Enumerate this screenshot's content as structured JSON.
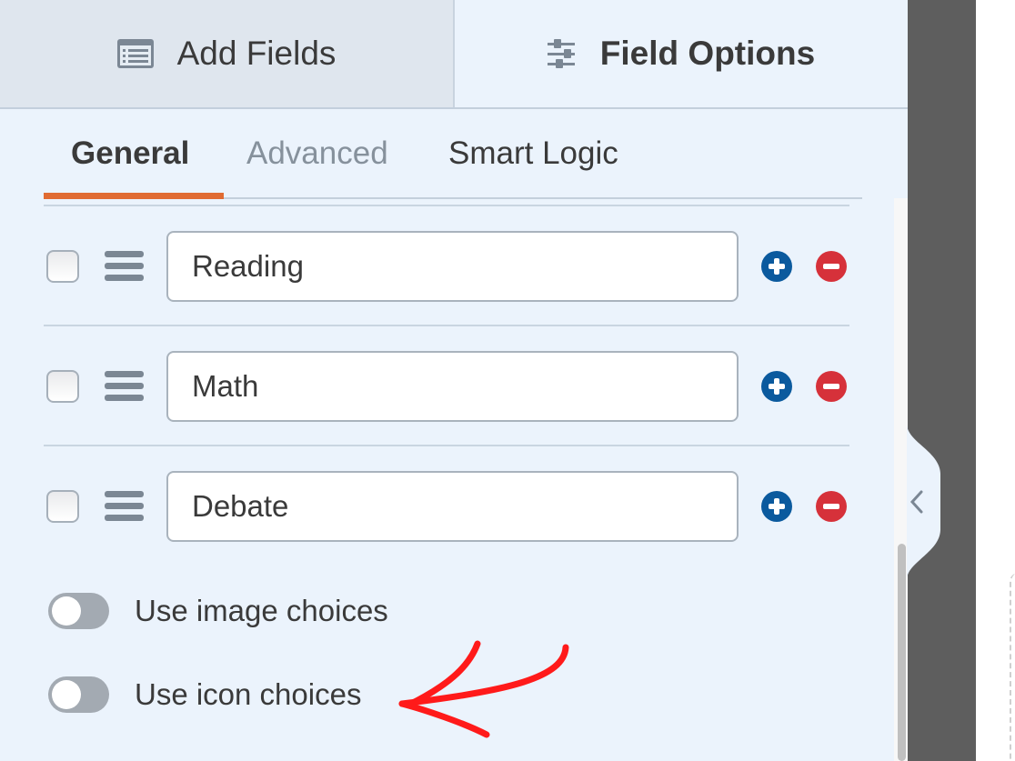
{
  "top_tabs": {
    "add_fields": {
      "label": "Add Fields",
      "icon": "form-list-icon"
    },
    "field_options": {
      "label": "Field Options",
      "icon": "sliders-icon",
      "active": true
    }
  },
  "sub_tabs": [
    {
      "label": "General",
      "active": true
    },
    {
      "label": "Advanced",
      "active": false
    },
    {
      "label": "Smart Logic",
      "active": false
    }
  ],
  "choices": [
    {
      "value": "Reading",
      "checked": false
    },
    {
      "value": "Math",
      "checked": false
    },
    {
      "value": "Debate",
      "checked": false
    }
  ],
  "toggles": [
    {
      "label": "Use image choices",
      "on": false
    },
    {
      "label": "Use icon choices",
      "on": false
    }
  ],
  "colors": {
    "panel_bg": "#ebf3fc",
    "active_tab_underline": "#e06b32",
    "add_button": "#0b5a9e",
    "remove_button": "#d6313a",
    "annotation_arrow": "#ff1a1a"
  },
  "annotation": {
    "type": "arrow",
    "points_to": "Use icon choices"
  }
}
